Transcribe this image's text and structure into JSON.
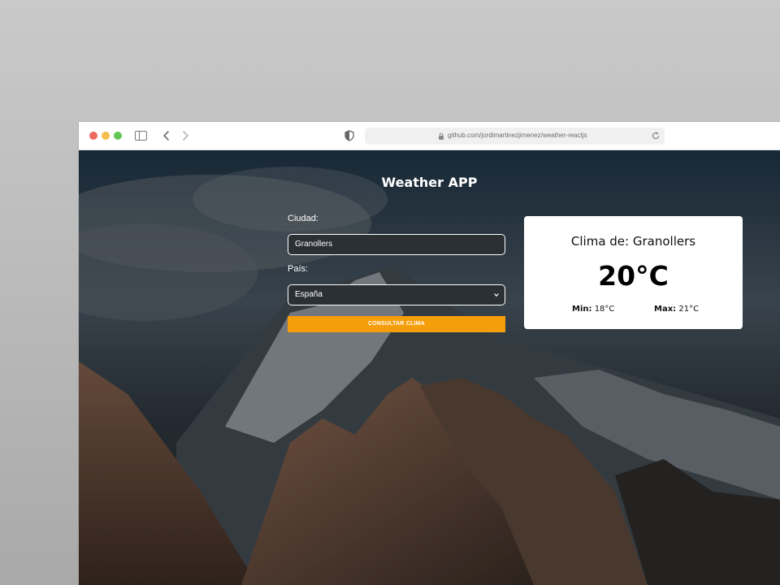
{
  "browser": {
    "url": "github.com/jordimartinezjimenez/weather-reactjs"
  },
  "app": {
    "title": "Weather APP"
  },
  "form": {
    "city_label": "Ciudad:",
    "city_value": "Granollers",
    "country_label": "País:",
    "country_value": "España",
    "submit_label": "CONSULTAR CLIMA"
  },
  "weather": {
    "title": "Clima de: Granollers",
    "temperature": "20°C",
    "min_label": "Min:",
    "min_value": "18°C",
    "max_label": "Max:",
    "max_value": "21°C"
  },
  "colors": {
    "accent": "#f59e0b",
    "card_bg": "#ffffff",
    "traffic_red": "#ee6a5f",
    "traffic_yellow": "#f5be4f",
    "traffic_green": "#62c655"
  },
  "icons": [
    "close-dot-icon",
    "minimize-dot-icon",
    "maximize-dot-icon",
    "sidebar-icon",
    "back-arrow-icon",
    "forward-arrow-icon",
    "shield-icon",
    "lock-icon",
    "reload-icon",
    "chevron-down-icon"
  ]
}
